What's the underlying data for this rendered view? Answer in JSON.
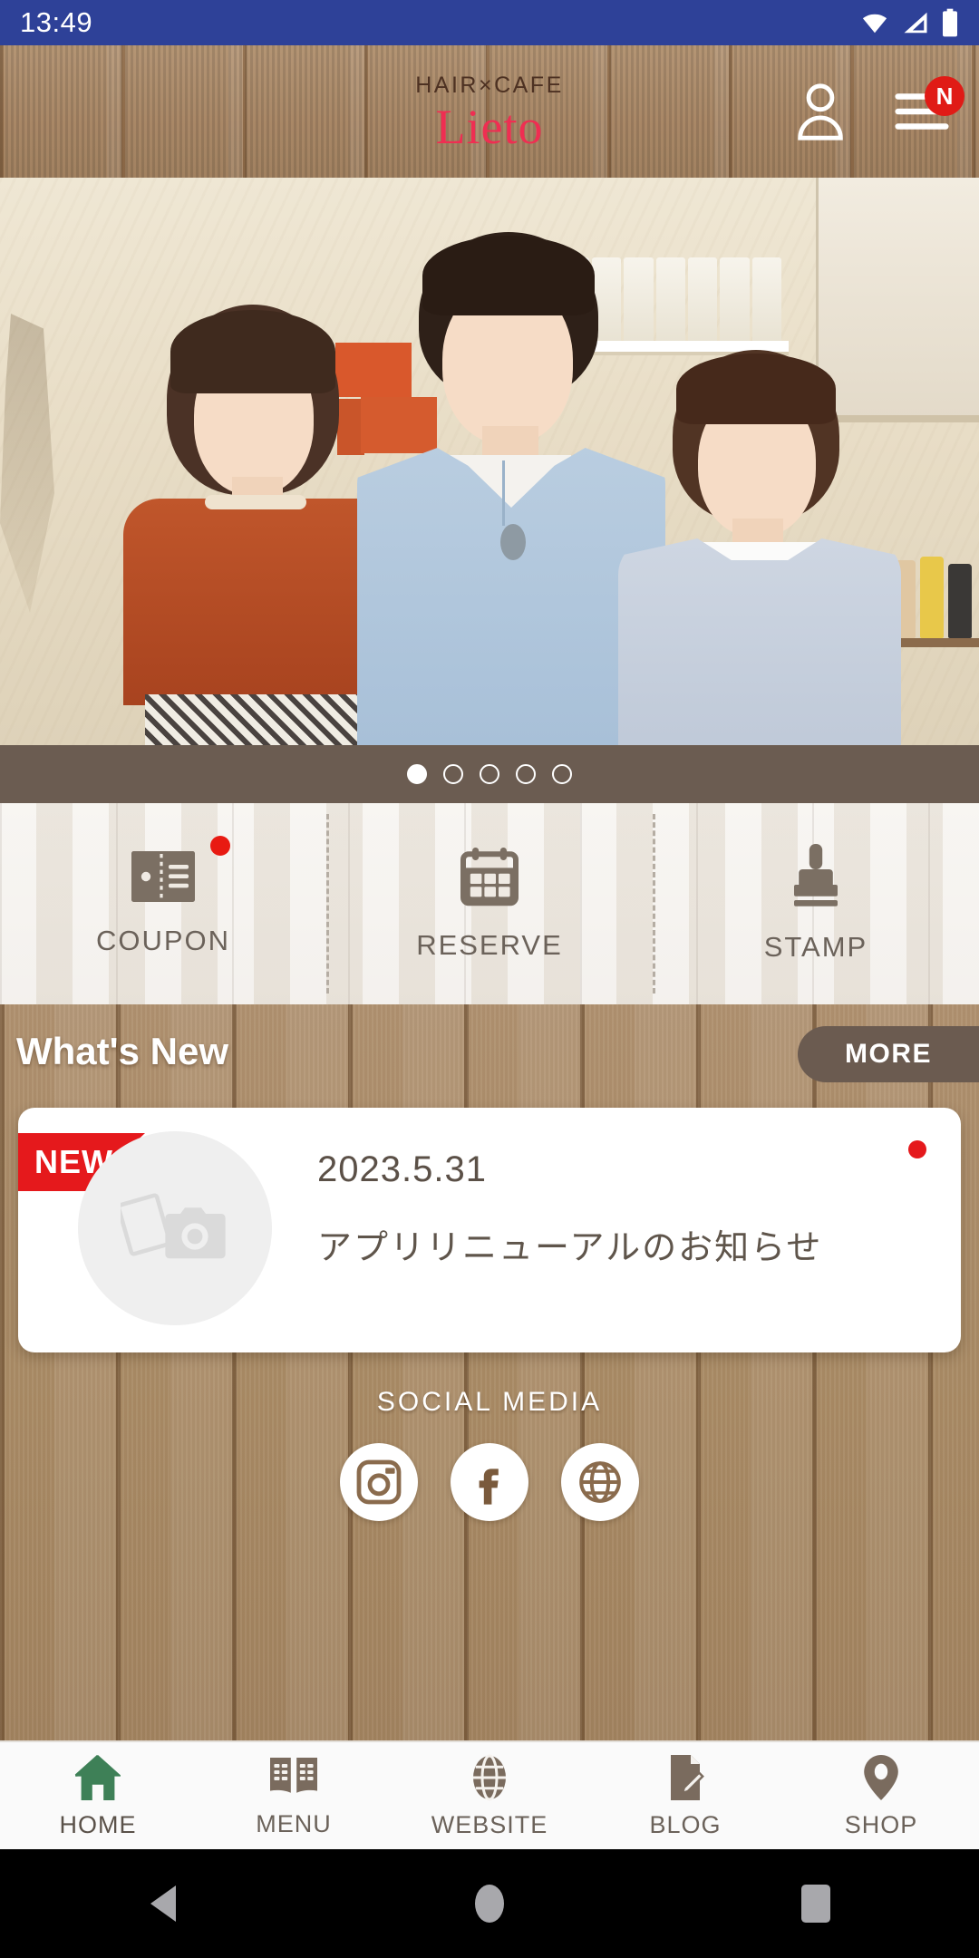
{
  "status_bar": {
    "time": "13:49",
    "background": "#2e4198",
    "icons": [
      "wifi-icon",
      "cellular-signal-icon",
      "battery-icon"
    ]
  },
  "header": {
    "logo_top": "HAIR×CAFE",
    "logo_main": "Lieto",
    "logo_top_color": "#4d3122",
    "logo_main_color": "#ef2e52",
    "account_icon": "person-icon",
    "menu_icon": "hamburger-menu-icon",
    "menu_badge": "N",
    "menu_badge_color": "#e01b16"
  },
  "carousel": {
    "total_slides": 5,
    "active_index": 0,
    "strip_background": "#6b5c51"
  },
  "actions": [
    {
      "label": "COUPON",
      "icon": "coupon-ticket-icon",
      "has_badge": true
    },
    {
      "label": "RESERVE",
      "icon": "calendar-icon",
      "has_badge": false
    },
    {
      "label": "STAMP",
      "icon": "stamp-icon",
      "has_badge": false
    }
  ],
  "whats_new": {
    "title": "What's New",
    "more_label": "MORE",
    "more_background": "#6b5b50",
    "items": [
      {
        "badge": "NEW",
        "badge_color": "#e5191c",
        "date": "2023.5.31",
        "title": "アプリリニューアルのお知らせ",
        "thumb_icon": "photo-camera-placeholder-icon",
        "unread": true
      }
    ]
  },
  "social": {
    "title": "SOCIAL MEDIA",
    "items": [
      {
        "name": "instagram-icon"
      },
      {
        "name": "facebook-icon"
      },
      {
        "name": "website-globe-icon"
      }
    ]
  },
  "bottom_nav": {
    "active_index": 0,
    "active_color": "#3e8057",
    "inactive_color": "#6f6259",
    "items": [
      {
        "label": "HOME",
        "icon": "home-icon"
      },
      {
        "label": "MENU",
        "icon": "book-icon"
      },
      {
        "label": "WEBSITE",
        "icon": "globe-icon"
      },
      {
        "label": "BLOG",
        "icon": "document-pen-icon"
      },
      {
        "label": "SHOP",
        "icon": "map-pin-icon"
      }
    ]
  },
  "system_nav": {
    "items": [
      {
        "name": "back-button"
      },
      {
        "name": "home-button"
      },
      {
        "name": "recents-button"
      }
    ]
  }
}
